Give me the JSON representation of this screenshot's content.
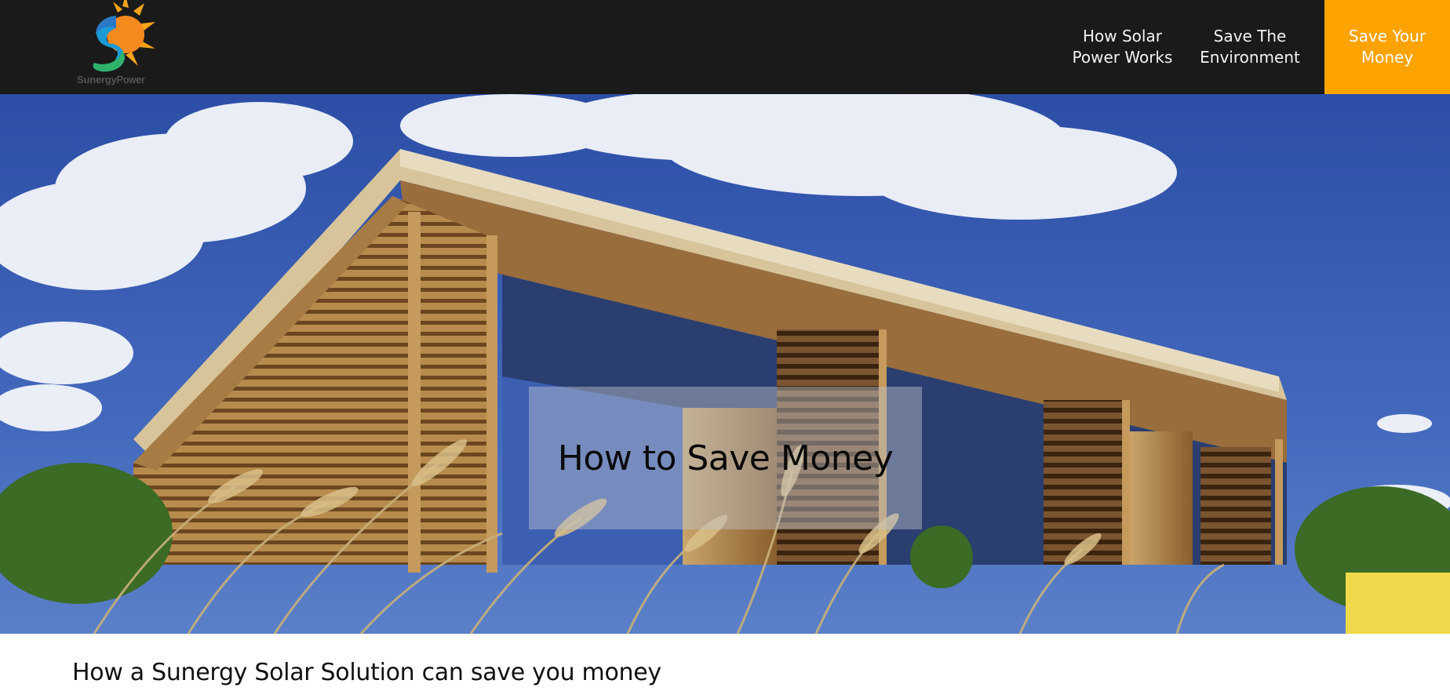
{
  "brand": {
    "logo_word_1": "Sunergy",
    "logo_word_2": "Power"
  },
  "nav": {
    "items": [
      {
        "label": "How Solar\nPower Works",
        "active": false
      },
      {
        "label": "Save The\nEnvironment",
        "active": false
      },
      {
        "label": "Save Your\nMoney",
        "active": true
      }
    ]
  },
  "hero": {
    "title": "How to Save Money"
  },
  "content": {
    "heading": "How a Sunergy Solar Solution can save you money"
  },
  "colors": {
    "navbar_bg": "#1a1a1a",
    "accent": "#ffa300",
    "nav_text": "#f2f2f2"
  },
  "icons": {
    "logo": "sunergy-sun-logo"
  }
}
